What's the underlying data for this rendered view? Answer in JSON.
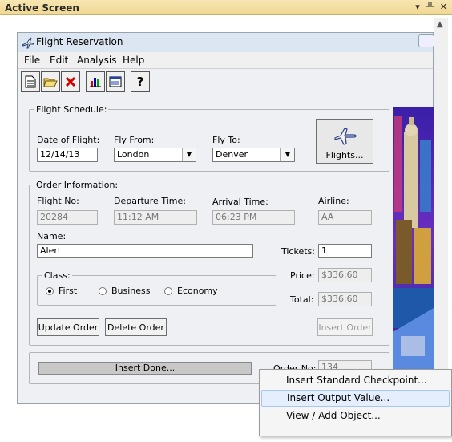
{
  "pane": {
    "title": "Active Screen",
    "buttons": [
      "▾",
      "ᵖ",
      "✕"
    ]
  },
  "window": {
    "title": "Flight Reservation",
    "menu": [
      "File",
      "Edit",
      "Analysis",
      "Help"
    ],
    "toolbar": [
      "new-icon",
      "open-icon",
      "delete-icon",
      "chart-icon",
      "calendar-icon",
      "help-icon"
    ]
  },
  "schedule": {
    "legend": "Flight Schedule:",
    "date_label": "Date of Flight:",
    "date_value": "12/14/13",
    "from_label": "Fly From:",
    "from_value": "London",
    "to_label": "Fly To:",
    "to_value": "Denver",
    "flights_button": "Flights..."
  },
  "order": {
    "legend": "Order Information:",
    "flight_no_label": "Flight No:",
    "flight_no": "20284",
    "departure_label": "Departure Time:",
    "departure": "11:12 AM",
    "arrival_label": "Arrival Time:",
    "arrival": "06:23 PM",
    "airline_label": "Airline:",
    "airline": "AA",
    "name_label": "Name:",
    "name": "Alert",
    "tickets_label": "Tickets:",
    "tickets": "1",
    "class_legend": "Class:",
    "class_options": [
      "First",
      "Business",
      "Economy"
    ],
    "class_selected": "First",
    "price_label": "Price:",
    "price": "$336.60",
    "total_label": "Total:",
    "total": "$336.60",
    "update_button": "Update Order",
    "delete_button": "Delete Order",
    "insert_button": "Insert Order"
  },
  "status": {
    "progress_text": "Insert Done...",
    "order_no_label": "Order No:",
    "order_no": "134"
  },
  "context_menu": {
    "items": [
      "Insert Standard Checkpoint...",
      "Insert Output Value...",
      "View / Add Object...",
      ""
    ],
    "highlighted": "Insert Output Value..."
  }
}
